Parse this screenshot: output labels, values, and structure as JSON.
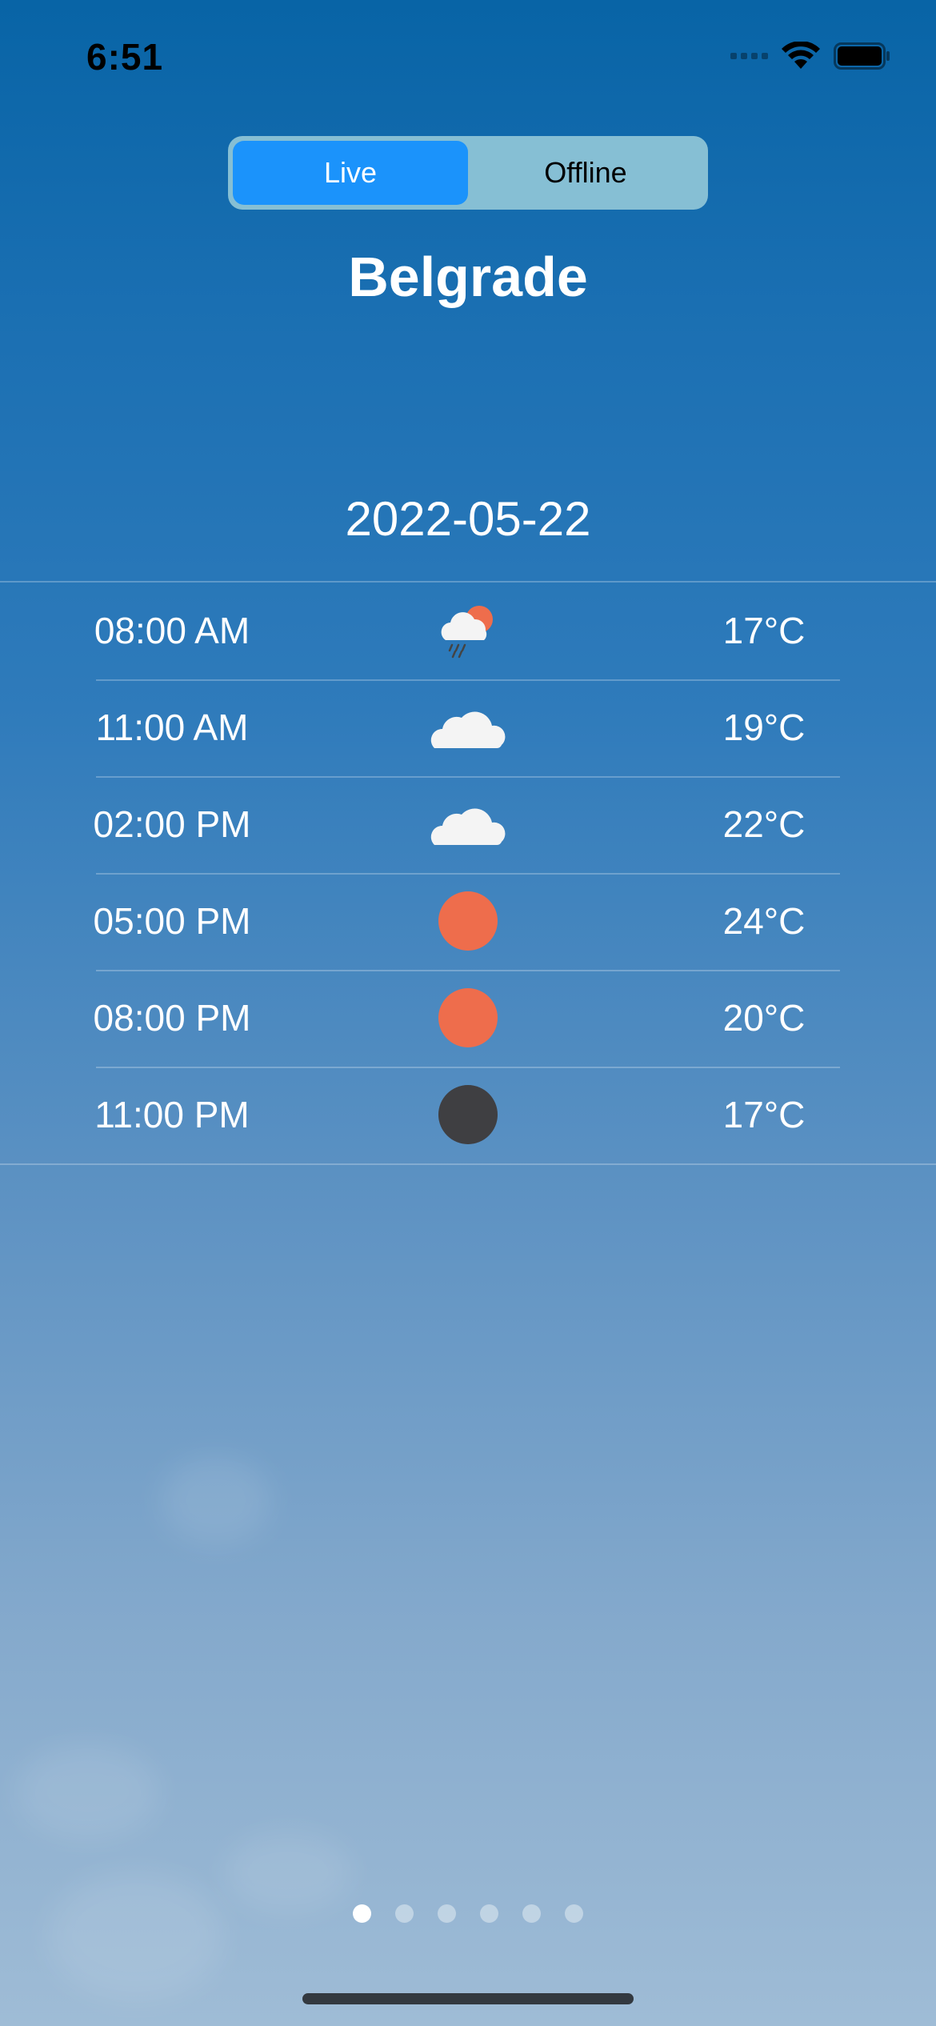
{
  "status_bar": {
    "time": "6:51"
  },
  "mode_toggle": {
    "options": [
      "Live",
      "Offline"
    ],
    "selected": "Live"
  },
  "city": "Belgrade",
  "date": "2022-05-22",
  "forecast": [
    {
      "time": "08:00 AM",
      "icon": "sun-cloud-rain-icon",
      "temp": "17°C"
    },
    {
      "time": "11:00 AM",
      "icon": "cloud-icon",
      "temp": "19°C"
    },
    {
      "time": "02:00 PM",
      "icon": "cloud-icon",
      "temp": "22°C"
    },
    {
      "time": "05:00 PM",
      "icon": "sun-icon",
      "temp": "24°C"
    },
    {
      "time": "08:00 PM",
      "icon": "sun-icon",
      "temp": "20°C"
    },
    {
      "time": "11:00 PM",
      "icon": "moon-icon",
      "temp": "17°C"
    }
  ],
  "pager": {
    "total": 6,
    "current": 1
  },
  "colors": {
    "accent": "#1b93fb",
    "sun": "#ee6d4c",
    "moon": "#3f3f42",
    "segment_bg": "#86bfd4"
  }
}
